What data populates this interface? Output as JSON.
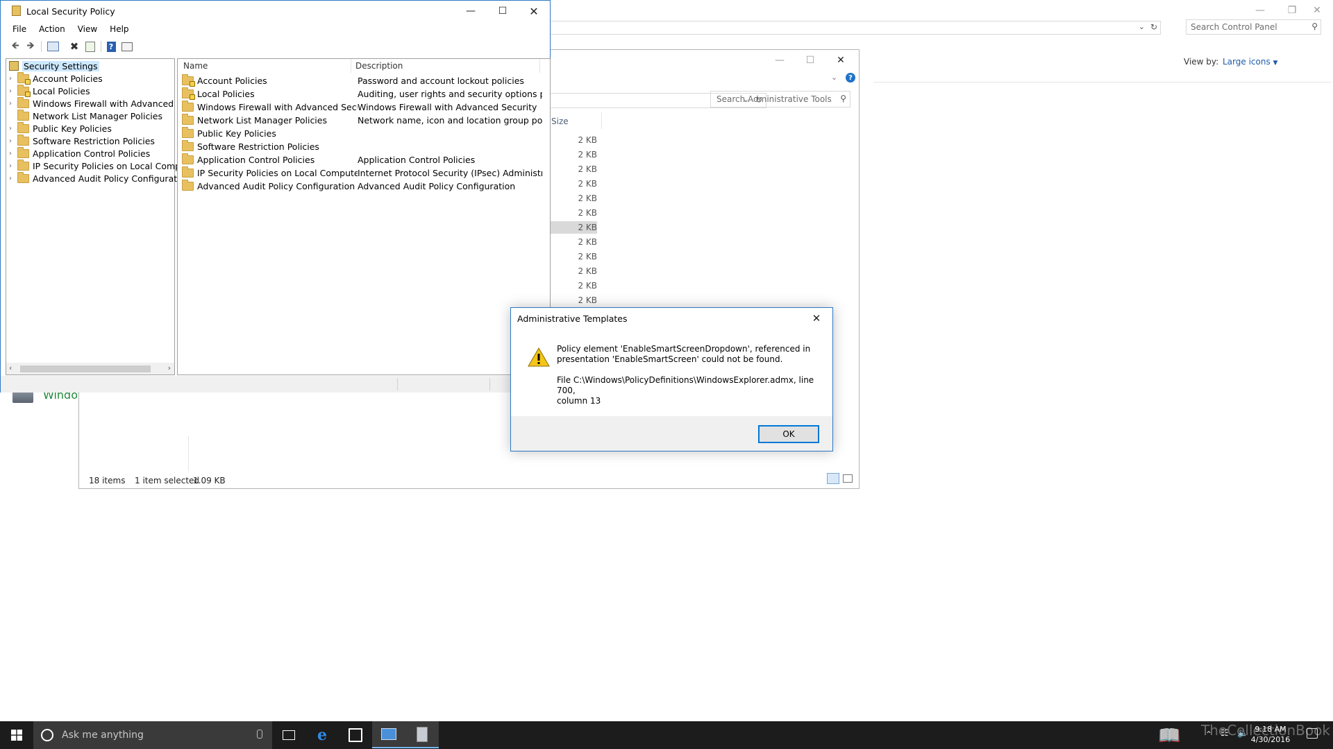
{
  "control_panel": {
    "search_placeholder": "Search Control Panel",
    "view_by_label": "View by:",
    "view_by_value": "Large icons",
    "bg_item_label": "Windov"
  },
  "admin_tools": {
    "search_placeholder": "Search Administrative Tools",
    "size_header": "Size",
    "sizes": [
      "2 KB",
      "2 KB",
      "2 KB",
      "2 KB",
      "2 KB",
      "2 KB",
      "2 KB",
      "2 KB",
      "2 KB",
      "2 KB",
      "2 KB",
      "2 KB"
    ],
    "status_items": "18 items",
    "status_selected": "1 item selected",
    "status_size": "1.09 KB"
  },
  "lsp": {
    "title": "Local Security Policy",
    "menu": [
      "File",
      "Action",
      "View",
      "Help"
    ],
    "tree_root": "Security Settings",
    "tree": [
      "Account Policies",
      "Local Policies",
      "Windows Firewall with Advanced Secu",
      "Network List Manager Policies",
      "Public Key Policies",
      "Software Restriction Policies",
      "Application Control Policies",
      "IP Security Policies on Local Compute",
      "Advanced Audit Policy Configuration"
    ],
    "columns": {
      "name": "Name",
      "description": "Description"
    },
    "rows": [
      {
        "name": "Account Policies",
        "description": "Password and account lockout policies"
      },
      {
        "name": "Local Policies",
        "description": "Auditing, user rights and security options polici..."
      },
      {
        "name": "Windows Firewall with Advanced Security",
        "description": "Windows Firewall with Advanced Security"
      },
      {
        "name": "Network List Manager Policies",
        "description": "Network name, icon and location group policies."
      },
      {
        "name": "Public Key Policies",
        "description": ""
      },
      {
        "name": "Software Restriction Policies",
        "description": ""
      },
      {
        "name": "Application Control Policies",
        "description": "Application Control Policies"
      },
      {
        "name": "IP Security Policies on Local Computer",
        "description": "Internet Protocol Security (IPsec) Administratio..."
      },
      {
        "name": "Advanced Audit Policy Configuration",
        "description": "Advanced Audit Policy Configuration"
      }
    ]
  },
  "dialog": {
    "title": "Administrative Templates",
    "message_line1": "Policy element 'EnableSmartScreenDropdown', referenced in",
    "message_line2": "presentation 'EnableSmartScreen' could not be found.",
    "detail_line1": "File C:\\Windows\\PolicyDefinitions\\WindowsExplorer.admx, line 700,",
    "detail_line2": "column 13",
    "ok_label": "OK"
  },
  "taskbar": {
    "search_placeholder": "Ask me anything",
    "time": "9:18 AM",
    "date": "4/30/2016",
    "watermark": "TheCollectionBook"
  },
  "colors": {
    "taskbar_bg": "#1c1c1c",
    "accent": "#0078d7",
    "window_border": "#2b79c2",
    "link_blue": "#1e5aa8"
  }
}
